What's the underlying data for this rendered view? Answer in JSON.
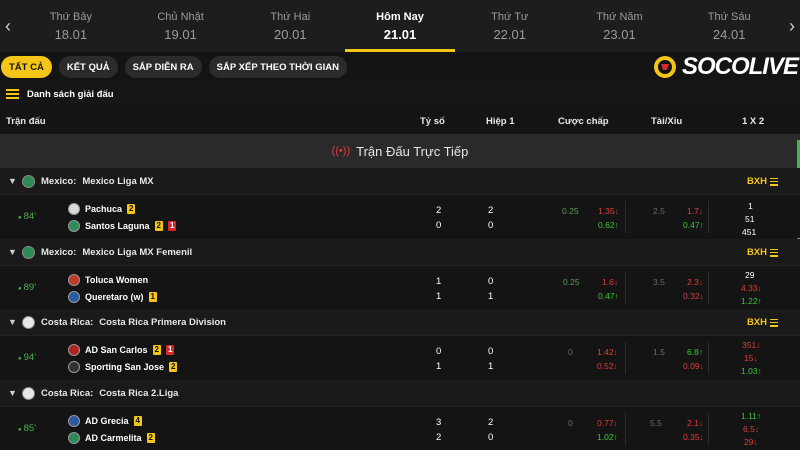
{
  "dates": [
    {
      "day": "Thứ Bảy",
      "date": "18.01"
    },
    {
      "day": "Chủ Nhật",
      "date": "19.01"
    },
    {
      "day": "Thứ Hai",
      "date": "20.01"
    },
    {
      "day": "Hôm Nay",
      "date": "21.01",
      "active": true
    },
    {
      "day": "Thứ Tư",
      "date": "22.01"
    },
    {
      "day": "Thứ Năm",
      "date": "23.01"
    },
    {
      "day": "Thứ Sáu",
      "date": "24.01"
    }
  ],
  "nav": {
    "prev": "‹",
    "next": "›"
  },
  "filters": [
    "TẤT CẢ",
    "KẾT QUẢ",
    "SẮP DIỄN RA",
    "SẮP XẾP THEO THỜI GIAN"
  ],
  "logo_text": "SOCOLIVE",
  "league_list_label": "Danh sách giải đấu",
  "columns": {
    "match": "Trận đấu",
    "score": "Tỷ số",
    "half": "Hiệp 1",
    "handicap": "Cược chấp",
    "ou": "Tài/Xỉu",
    "x12": "1 X 2"
  },
  "live_title": "Trận Đấu Trực Tiếp",
  "bxh_label": "BXH",
  "leagues": [
    {
      "country": "Mexico:",
      "name": "Mexico Liga MX",
      "bxh": true
    },
    {
      "country": "Mexico:",
      "name": "Mexico Liga MX Femenil",
      "bxh": true
    },
    {
      "country": "Costa Rica:",
      "name": "Costa Rica Primera Division",
      "bxh": true
    },
    {
      "country": "Costa Rica:",
      "name": "Costa Rica 2.Liga",
      "bxh": false
    }
  ],
  "matches": [
    {
      "minute": "84'",
      "home": {
        "name": "Pachuca",
        "yellow": "2",
        "red": ""
      },
      "away": {
        "name": "Santos Laguna",
        "yellow": "2",
        "red": "1"
      },
      "score": [
        "2",
        "0"
      ],
      "half": [
        "2",
        "0"
      ],
      "hdp_line": "0.25",
      "hdp": [
        "1.35↓",
        "0.62↑"
      ],
      "ou_line": "2.5",
      "ou": [
        "1.7↓",
        "0.47↑"
      ],
      "x12": [
        "1",
        "51",
        "451"
      ]
    },
    {
      "minute": "89'",
      "home": {
        "name": "Toluca Women",
        "yellow": "",
        "red": ""
      },
      "away": {
        "name": "Queretaro (w)",
        "yellow": "1",
        "red": ""
      },
      "score": [
        "1",
        "1"
      ],
      "half": [
        "0",
        "1"
      ],
      "hdp_line": "0.25",
      "hdp": [
        "1.6↓",
        "0.47↑"
      ],
      "ou_line": "3.5",
      "ou": [
        "2.3↓",
        "0.32↓"
      ],
      "x12": [
        "29",
        "4.33↓",
        "1.22↑"
      ]
    },
    {
      "minute": "94'",
      "home": {
        "name": "AD San Carlos",
        "yellow": "2",
        "red": "1"
      },
      "away": {
        "name": "Sporting San Jose",
        "yellow": "2",
        "red": ""
      },
      "score": [
        "0",
        "1"
      ],
      "half": [
        "0",
        "1"
      ],
      "hdp_line": "0",
      "hdp": [
        "1.42↓",
        "0.52↓"
      ],
      "ou_line": "1.5",
      "ou": [
        "6.8↑",
        "0.09↓"
      ],
      "x12": [
        "351↓",
        "15↓",
        "1.03↑"
      ]
    },
    {
      "minute": "85'",
      "home": {
        "name": "AD Grecia",
        "yellow": "4",
        "red": ""
      },
      "away": {
        "name": "AD Carmelita",
        "yellow": "2",
        "red": ""
      },
      "score": [
        "3",
        "2"
      ],
      "half": [
        "2",
        "0"
      ],
      "hdp_line": "0",
      "hdp": [
        "0.77↓",
        "1.02↑"
      ],
      "ou_line": "5.5",
      "ou": [
        "2.1↓",
        "0.35↓"
      ],
      "x12": [
        "1.11↑",
        "6.5↓",
        "29↓"
      ]
    }
  ]
}
